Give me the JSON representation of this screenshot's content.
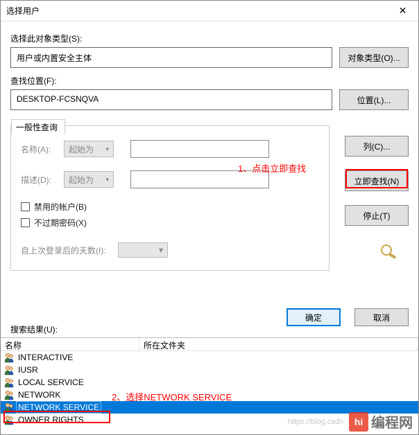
{
  "window": {
    "title": "选择用户",
    "close": "✕"
  },
  "objType": {
    "label": "选择此对象类型(S):",
    "value": "用户或内置安全主体",
    "btn": "对象类型(O)..."
  },
  "location": {
    "label": "查找位置(F):",
    "value": "DESKTOP-FCSNQVA",
    "btn": "位置(L)..."
  },
  "query": {
    "legend": "一般性查询",
    "nameLabel": "名称(A):",
    "nameMode": "起始为",
    "descLabel": "描述(D):",
    "descMode": "起始为",
    "chkDisabled": "禁用的帐户(B)",
    "chkNoExpire": "不过期密码(X)",
    "daysLabel": "自上次登录后的天数(I):"
  },
  "sideBtns": {
    "columns": "列(C)...",
    "findNow": "立即查找(N)",
    "stop": "停止(T)"
  },
  "anno": {
    "a1": "1、点击立即查找",
    "a2": "2、选择NETWORK SERVICE"
  },
  "dlgBtns": {
    "ok": "确定",
    "cancel": "取消"
  },
  "results": {
    "label": "搜索结果(U):",
    "col1": "名称",
    "col2": "所在文件夹",
    "rows": [
      {
        "name": "INTERACTIVE",
        "selected": false
      },
      {
        "name": "IUSR",
        "selected": false
      },
      {
        "name": "LOCAL SERVICE",
        "selected": false
      },
      {
        "name": "NETWORK",
        "selected": false
      },
      {
        "name": "NETWORK SERVICE",
        "selected": true
      },
      {
        "name": "OWNER RIGHTS",
        "selected": false
      }
    ]
  },
  "watermark": {
    "url": "https://blog.csdn",
    "logo": "hi",
    "text": "编程网"
  }
}
